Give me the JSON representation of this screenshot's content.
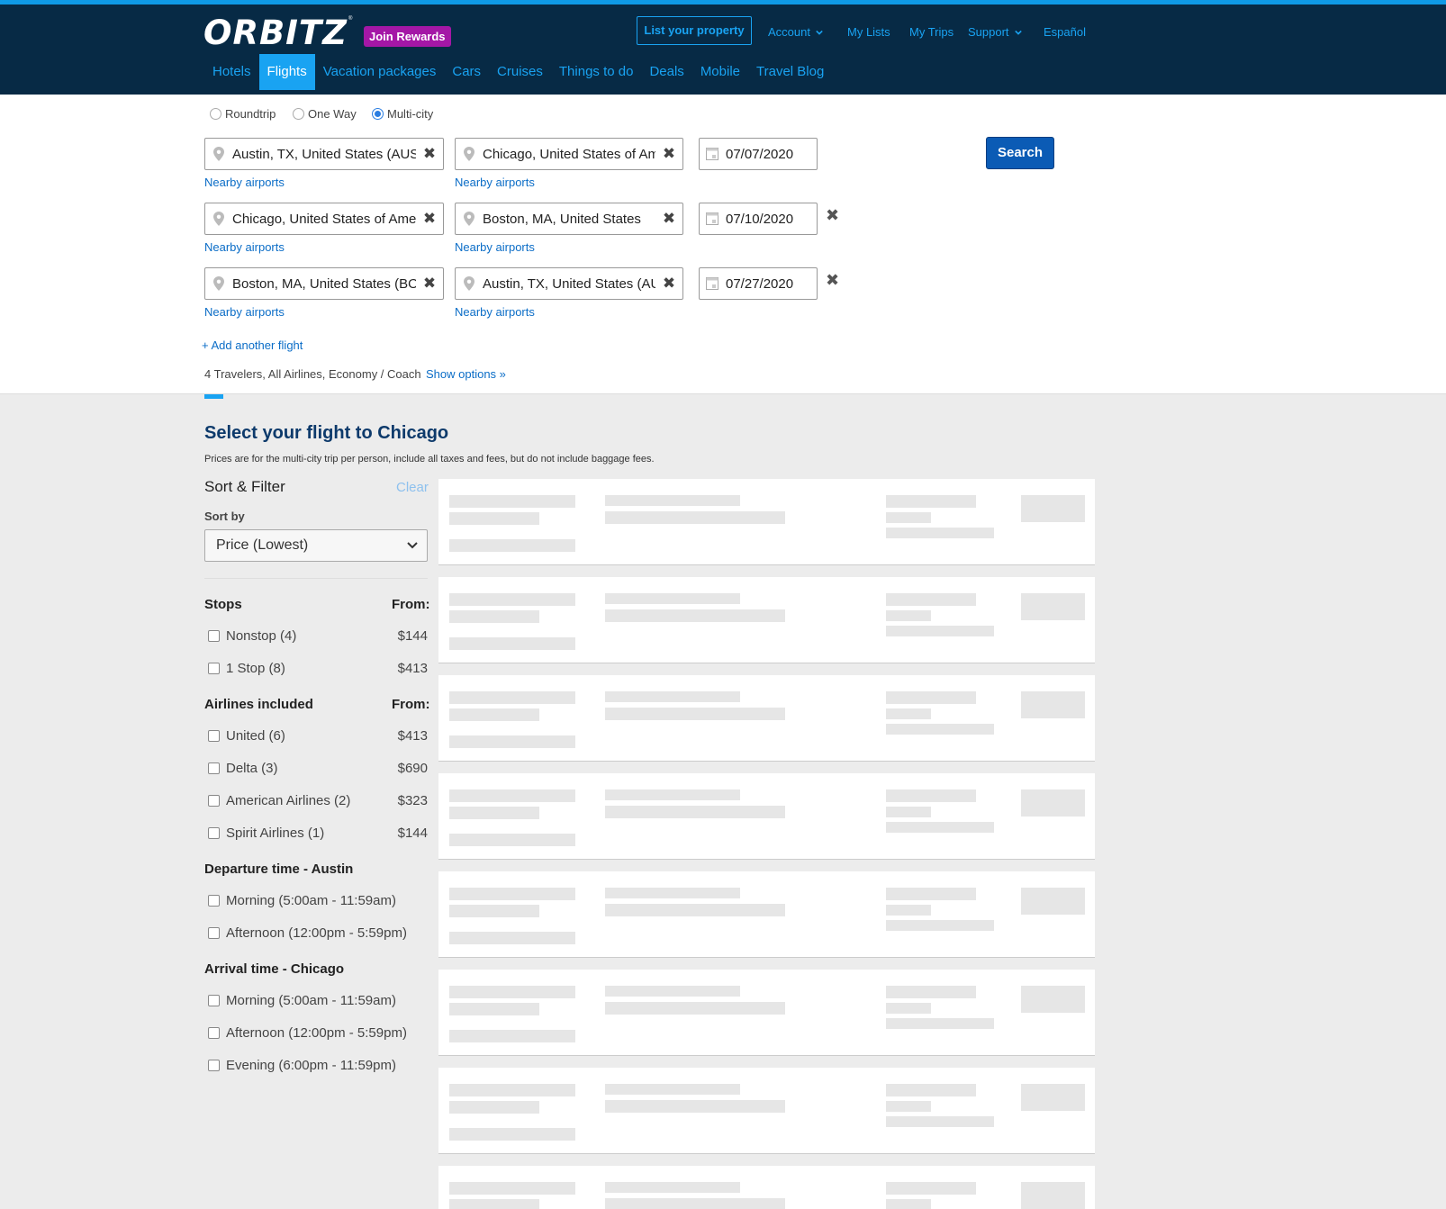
{
  "brand": {
    "logo": "ORBITZ",
    "registered": "®",
    "rewards_label": "Join Rewards"
  },
  "header": {
    "list_property": "List your property",
    "account": "Account",
    "my_lists": "My Lists",
    "my_trips": "My Trips",
    "support": "Support",
    "language": "Español",
    "nav": [
      {
        "label": "Hotels",
        "active": false
      },
      {
        "label": "Flights",
        "active": true
      },
      {
        "label": "Vacation packages",
        "active": false
      },
      {
        "label": "Cars",
        "active": false
      },
      {
        "label": "Cruises",
        "active": false
      },
      {
        "label": "Things to do",
        "active": false
      },
      {
        "label": "Deals",
        "active": false
      },
      {
        "label": "Mobile",
        "active": false
      },
      {
        "label": "Travel Blog",
        "active": false
      }
    ]
  },
  "search": {
    "trip_types": [
      {
        "label": "Roundtrip",
        "selected": false
      },
      {
        "label": "One Way",
        "selected": false
      },
      {
        "label": "Multi-city",
        "selected": true
      }
    ],
    "flights": [
      {
        "from": "Austin, TX, United States (AUS-Austin-Bergstrom Intl.)",
        "to": "Chicago, United States of America",
        "date": "07/07/2020"
      },
      {
        "from": "Chicago, United States of America",
        "to": "Boston, MA, United States",
        "date": "07/10/2020"
      },
      {
        "from": "Boston, MA, United States (BOS-Logan Intl.)",
        "to": "Austin, TX, United States (AUS-Austin-Bergstrom Intl.)",
        "date": "07/27/2020"
      }
    ],
    "nearby_label": "Nearby airports",
    "clear_icon": "✖",
    "remove_icon": "✖",
    "search_button": "Search",
    "add_flight": "+ Add another flight",
    "travelers_summary": "4 Travelers, All Airlines, Economy / Coach",
    "show_options": "Show options »"
  },
  "results": {
    "title": "Select your flight to Chicago",
    "note": "Prices are for the multi-city trip per person, include all taxes and fees, but do not include baggage fees.",
    "loading_cards": 8
  },
  "filters": {
    "heading": "Sort & Filter",
    "clear": "Clear",
    "sort_label": "Sort by",
    "sort_value": "Price (Lowest)",
    "groups": [
      {
        "title": "Stops",
        "from_label": "From:",
        "options": [
          {
            "label": "Nonstop (4)",
            "price": "$144"
          },
          {
            "label": "1 Stop (8)",
            "price": "$413"
          }
        ]
      },
      {
        "title": "Airlines included",
        "from_label": "From:",
        "options": [
          {
            "label": "United (6)",
            "price": "$413"
          },
          {
            "label": "Delta (3)",
            "price": "$690"
          },
          {
            "label": "American Airlines (2)",
            "price": "$323"
          },
          {
            "label": "Spirit Airlines (1)",
            "price": "$144"
          }
        ]
      },
      {
        "title": "Departure time - Austin",
        "from_label": "",
        "options": [
          {
            "label": "Morning (5:00am - 11:59am)",
            "price": ""
          },
          {
            "label": "Afternoon (12:00pm - 5:59pm)",
            "price": ""
          }
        ]
      },
      {
        "title": "Arrival time - Chicago",
        "from_label": "",
        "options": [
          {
            "label": "Morning (5:00am - 11:59am)",
            "price": ""
          },
          {
            "label": "Afternoon (12:00pm - 5:59pm)",
            "price": ""
          },
          {
            "label": "Evening (6:00pm - 11:59pm)",
            "price": ""
          }
        ]
      }
    ]
  },
  "colors": {
    "header_bg": "#072a45",
    "accent": "#19a3f2",
    "rewards": "#a417a6",
    "search_button": "#0b5bb5",
    "link": "#0b6dc7",
    "title": "#0d3a6b"
  }
}
